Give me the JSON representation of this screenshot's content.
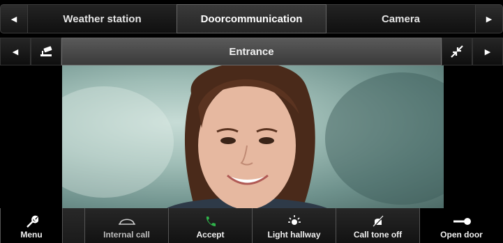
{
  "tabs": {
    "items": [
      {
        "label": "Weather station",
        "active": false
      },
      {
        "label": "Doorcommunication",
        "active": true
      },
      {
        "label": "Camera",
        "active": false
      }
    ]
  },
  "subbar": {
    "title": "Entrance",
    "left_icon": "camera-icon",
    "right_icon": "minimize-icon"
  },
  "video": {
    "icon": "door-camera-feed"
  },
  "toolbar": {
    "menu": "Menu",
    "internal_call": "Internal call",
    "accept": "Accept",
    "light_hallway": "Light hallway",
    "call_tone_off": "Call tone off",
    "open_door": "Open door"
  },
  "colors": {
    "accept_icon": "#2fb24a",
    "active_tab_border": "#666666",
    "title_bar": "#4a4a4a"
  }
}
